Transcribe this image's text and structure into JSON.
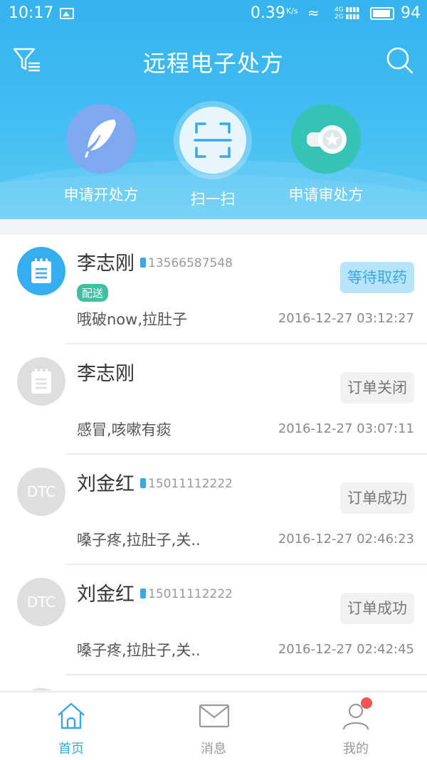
{
  "status_bar": {
    "time": "10:17",
    "speed": "0.39",
    "speed_unit": "K/s",
    "signal_label_4g": "4G",
    "signal_label_2g": "2G",
    "battery_level_percent": 94,
    "battery": "94"
  },
  "header": {
    "title": "远程电子处方",
    "filter_icon": "filter-icon",
    "search_icon": "search-icon"
  },
  "actions": [
    {
      "label": "申请开处方",
      "icon": "feather-icon",
      "color": "#7ea8ef"
    },
    {
      "label": "扫一扫",
      "icon": "scan-icon",
      "color": "#e6f6fc"
    },
    {
      "label": "申请审处方",
      "icon": "seal-stamp-icon",
      "color": "#35c3b6"
    }
  ],
  "orders": [
    {
      "name": "李志刚",
      "phone": "13566587548",
      "tag": "配送",
      "status": "等待取药",
      "symptom": "哦破now,拉肚子",
      "time": "2016-12-27 03:12:27"
    },
    {
      "name": "李志刚",
      "phone": "",
      "tag": "",
      "status": "订单关闭",
      "symptom": "感冒,咳嗽有痰",
      "time": "2016-12-27 03:07:11"
    },
    {
      "name": "刘金红",
      "avatar_text": "DTC",
      "phone": "15011112222",
      "tag": "",
      "status": "订单成功",
      "symptom": "嗓子疼,拉肚子,关..",
      "time": "2016-12-27 02:46:23"
    },
    {
      "name": "刘金红",
      "avatar_text": "DTC",
      "phone": "15011112222",
      "tag": "",
      "status": "订单成功",
      "symptom": "嗓子疼,拉肚子,关..",
      "time": "2016-12-27 02:42:45"
    }
  ],
  "tabs": [
    {
      "label": "首页",
      "icon": "home-icon",
      "active": true
    },
    {
      "label": "消息",
      "icon": "mail-icon",
      "active": false
    },
    {
      "label": "我的",
      "icon": "user-icon",
      "active": false
    }
  ],
  "colors": {
    "primary": "#36adee",
    "tag_green": "#3fc0a3",
    "badge_red": "#f05454"
  }
}
